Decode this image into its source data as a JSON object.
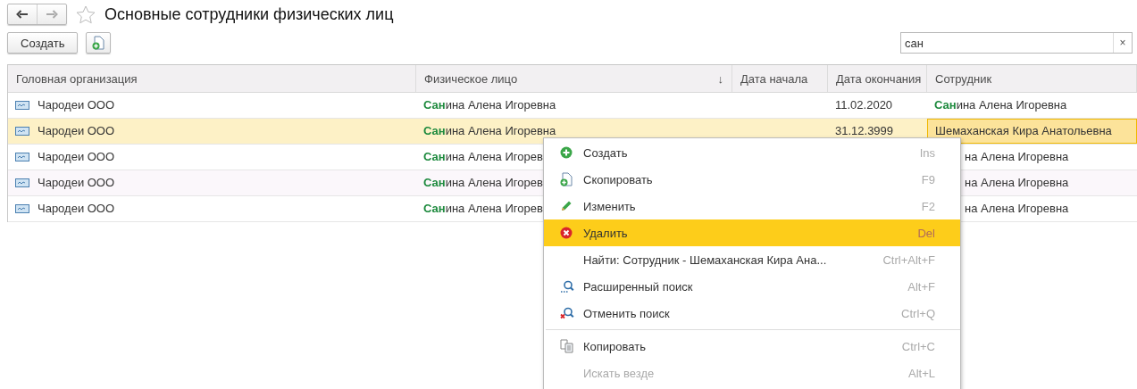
{
  "nav": {
    "title": "Основные сотрудники физических лиц"
  },
  "toolbar": {
    "create_label": "Создать",
    "search": {
      "value": "сан",
      "clear": "×"
    }
  },
  "table": {
    "columns": [
      {
        "label": "Головная организация"
      },
      {
        "label": "Физическое лицо",
        "sort": "↓"
      },
      {
        "label": "Дата начала"
      },
      {
        "label": "Дата окончания"
      },
      {
        "label": "Сотрудник"
      }
    ],
    "rows": [
      {
        "selected": false,
        "organization": "Чародеи ООО",
        "person": "**Сан**ина Алена Игоревна",
        "end_date": "11.02.2020",
        "employee": "**Сан**ина Алена Игоревна",
        "employee_selected": false
      },
      {
        "selected": true,
        "organization": "Чародеи ООО",
        "person": "**Сан**ина Алена Игоревна",
        "end_date": "31.12.3999",
        "employee": "Шемаханская Кира Анатольевна",
        "employee_selected": true
      },
      {
        "selected": false,
        "organization": "Чародеи ООО",
        "person": "**Сан**ина Алена Игорев",
        "employee": "на Алена Игоревна",
        "employee_selected": false
      },
      {
        "selected": false,
        "organization": "Чародеи ООО",
        "person": "**Сан**ина Алена Игорев",
        "employee": "на Алена Игоревна",
        "employee_selected": false
      },
      {
        "selected": false,
        "organization": "Чародеи ООО",
        "person": "**Сан**ина Алена Игорев",
        "employee": "на Алена Игоревна",
        "employee_selected": false
      }
    ]
  },
  "context_menu": {
    "items": [
      {
        "kind": "item",
        "label": "Создать",
        "shortcut": "Ins",
        "selected": false,
        "disabled": false
      },
      {
        "kind": "item",
        "label": "Скопировать",
        "shortcut": "F9",
        "selected": false,
        "disabled": false
      },
      {
        "kind": "item",
        "label": "Изменить",
        "shortcut": "F2",
        "selected": false,
        "disabled": false
      },
      {
        "kind": "item",
        "label": "Удалить",
        "shortcut": "Del",
        "selected": true,
        "disabled": false
      },
      {
        "kind": "item",
        "label": "Найти: Сотрудник - Шемаханская Кира Ана...",
        "shortcut": "Ctrl+Alt+F",
        "selected": false,
        "disabled": false
      },
      {
        "kind": "item",
        "label": "Расширенный поиск",
        "shortcut": "Alt+F",
        "selected": false,
        "disabled": false
      },
      {
        "kind": "item",
        "label": "Отменить поиск",
        "shortcut": "Ctrl+Q",
        "selected": false,
        "disabled": false
      },
      {
        "kind": "separator"
      },
      {
        "kind": "item",
        "label": "Копировать",
        "shortcut": "Ctrl+C",
        "selected": false,
        "disabled": false
      },
      {
        "kind": "item",
        "label": "Искать везде",
        "shortcut": "Alt+L",
        "selected": false,
        "disabled": true
      }
    ]
  }
}
